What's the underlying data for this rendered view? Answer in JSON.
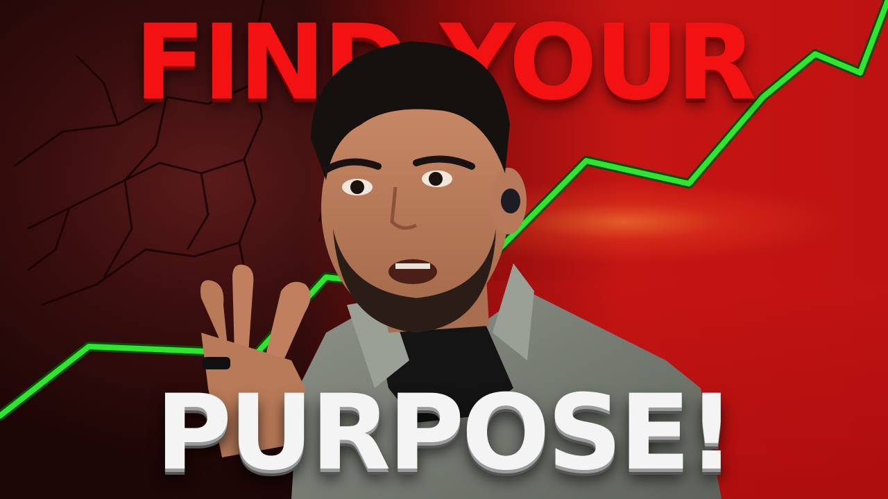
{
  "headline": {
    "top": "FIND YOUR",
    "bottom": "PURPOSE!"
  },
  "colors": {
    "headline_top": "#f21212",
    "headline_bottom": "#f4f4f4",
    "trend_line": "#2ee62e",
    "background_red": "#c81414"
  }
}
